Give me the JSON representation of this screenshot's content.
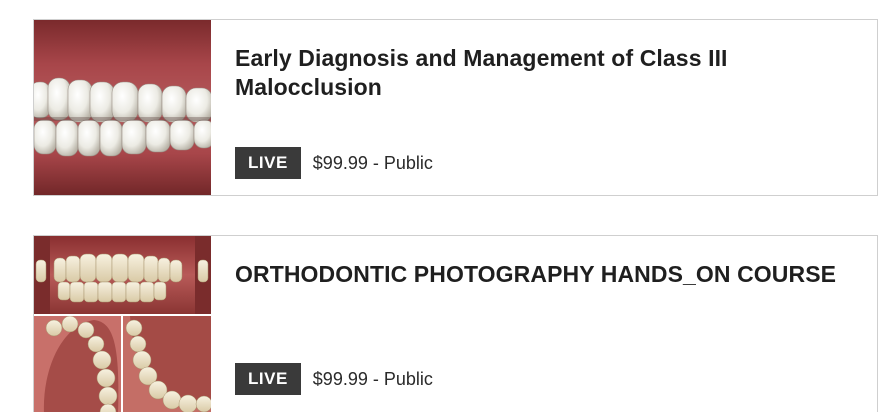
{
  "courses": [
    {
      "title": "Early Diagnosis and Management of Class III Malocclusion",
      "badge": "LIVE",
      "price": "$99.99 - Public",
      "image_icon": "teeth-closeup-photo"
    },
    {
      "title": "ORTHODONTIC PHOTOGRAPHY HANDS_ON COURSE",
      "badge": "LIVE",
      "price": "$99.99 - Public",
      "image_icon": "intraoral-photo-collage"
    }
  ],
  "colors": {
    "badge_bg": "#3a3a3a",
    "badge_text": "#ffffff",
    "card_border": "#cfcfcf",
    "title_text": "#1f1f1f"
  }
}
